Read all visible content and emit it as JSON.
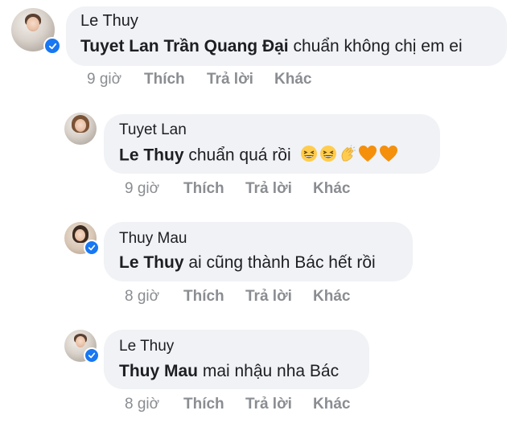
{
  "comments": [
    {
      "author": "Le Thuy",
      "mention": "Tuyet Lan Trần Quang Đại",
      "text": " chuẩn không chị em ei",
      "time": "9 giờ",
      "like": "Thích",
      "reply": "Trả lời",
      "more": "Khác"
    },
    {
      "author": "Tuyet Lan",
      "mention": "Le Thuy",
      "text": " chuẩn quá rồi",
      "emojis": [
        "grinning-squint-face",
        "grinning-squint-face",
        "clapping-hands",
        "orange-heart",
        "orange-heart"
      ],
      "time": "9 giờ",
      "like": "Thích",
      "reply": "Trả lời",
      "more": "Khác"
    },
    {
      "author": "Thuy Mau",
      "mention": "Le Thuy",
      "text": " ai cũng thành Bác hết rồi",
      "time": "8 giờ",
      "like": "Thích",
      "reply": "Trả lời",
      "more": "Khác"
    },
    {
      "author": "Le Thuy",
      "mention": "Thuy Mau",
      "text": " mai nhậu nha Bác",
      "time": "8 giờ",
      "like": "Thích",
      "reply": "Trả lời",
      "more": "Khác"
    }
  ],
  "colors": {
    "bubble": "#f0f2f5",
    "verified": "#1877f2",
    "meta": "#8a8d91",
    "text": "#1c1e21"
  }
}
